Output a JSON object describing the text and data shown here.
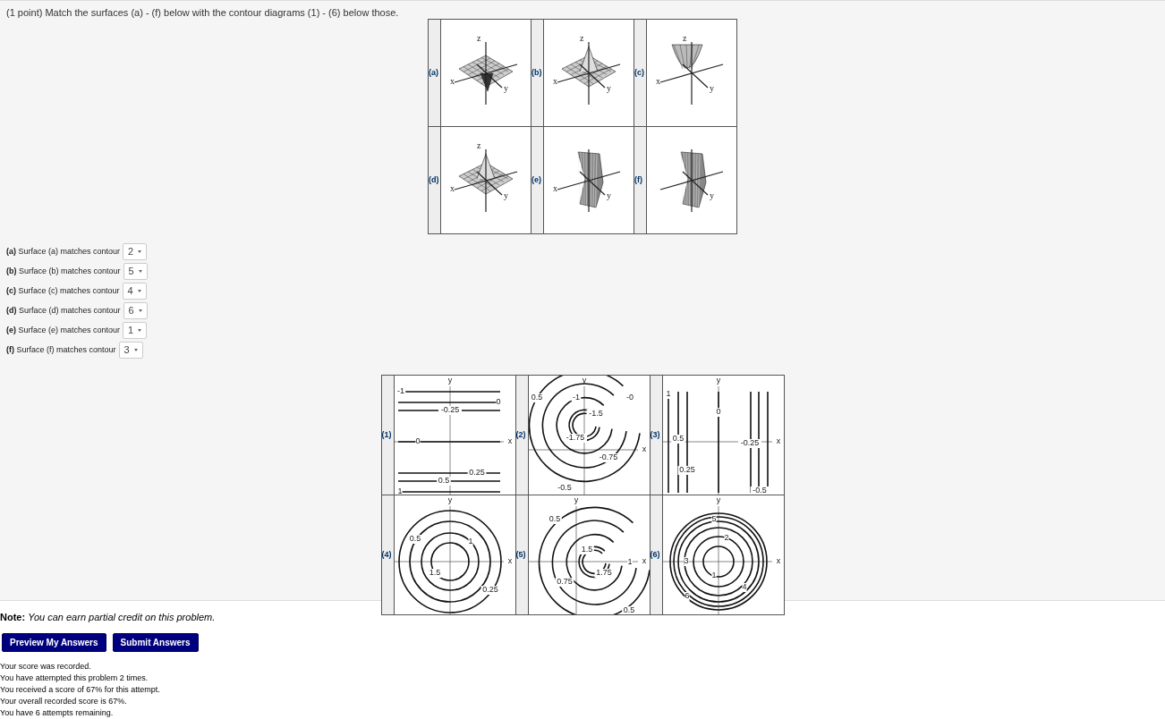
{
  "problem": {
    "statement": "(1 point) Match the surfaces (a) - (f) below with the contour diagrams (1) - (6) below those.",
    "surfaces": [
      {
        "label": "(a)",
        "kind": "well",
        "axes": [
          "z",
          "x",
          "y"
        ]
      },
      {
        "label": "(b)",
        "kind": "peak",
        "axes": [
          "z",
          "x",
          "y"
        ]
      },
      {
        "label": "(c)",
        "kind": "bowl",
        "axes": [
          "z",
          "x",
          "y"
        ]
      },
      {
        "label": "(d)",
        "kind": "peak",
        "axes": [
          "z",
          "x",
          "y"
        ]
      },
      {
        "label": "(e)",
        "kind": "sheet",
        "axes": [
          "x",
          "y"
        ]
      },
      {
        "label": "(f)",
        "kind": "sheet",
        "axes": [
          "y"
        ]
      }
    ],
    "answers": [
      {
        "prompt": "**(a)** Surface (a) matches contour",
        "value": "2"
      },
      {
        "prompt": "**(b)** Surface (b) matches contour",
        "value": "5"
      },
      {
        "prompt": "**(c)** Surface (c) matches contour",
        "value": "4"
      },
      {
        "prompt": "**(d)** Surface (d) matches contour",
        "value": "6"
      },
      {
        "prompt": "**(e)** Surface (e) matches contour",
        "value": "1"
      },
      {
        "prompt": "**(f)** Surface (f) matches contour",
        "value": "3"
      }
    ],
    "contours": [
      {
        "label": "(1)",
        "kind": "horizontal",
        "x_axis": "x",
        "y_axis": "y",
        "levels": [
          "-1",
          "0",
          "-0.25",
          "0",
          "0.25",
          "0.5",
          "1"
        ]
      },
      {
        "label": "(2)",
        "kind": "offset-rings",
        "x_axis": "x",
        "y_axis": "y",
        "levels": [
          "0.5",
          "-1",
          "-0",
          "-1.5",
          "-1.75",
          "-0.75",
          "-0.5"
        ]
      },
      {
        "label": "(3)",
        "kind": "vertical",
        "x_axis": "x",
        "y_axis": "y",
        "levels": [
          "1",
          "0",
          "0.5",
          "-0.25",
          "0.25",
          "-0.5"
        ]
      },
      {
        "label": "(4)",
        "kind": "rings",
        "x_axis": "x",
        "y_axis": "y",
        "levels": [
          "0.5",
          "1",
          "1.5",
          "0.25"
        ]
      },
      {
        "label": "(5)",
        "kind": "offset-rings",
        "x_axis": "x",
        "y_axis": "y",
        "levels": [
          "0.5",
          "1.5",
          "1",
          "1.75",
          "0.75",
          "0.5"
        ]
      },
      {
        "label": "(6)",
        "kind": "rings",
        "x_axis": "x",
        "y_axis": "y",
        "levels": [
          "5",
          "2",
          "3",
          "1",
          "4",
          "6"
        ]
      }
    ]
  },
  "note": "**Note:** *You can earn partial credit on this problem.*",
  "buttons": [
    "Preview My Answers",
    "Submit Answers"
  ],
  "messages": [
    "Your score was recorded.",
    "You have attempted this problem 2 times.",
    "You received a score of 67% for this attempt.",
    "Your overall recorded score is 67%.",
    "You have 6 attempts remaining."
  ]
}
